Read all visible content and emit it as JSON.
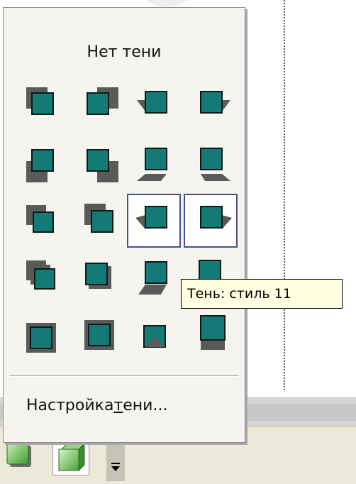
{
  "menu": {
    "no_shadow_label": "Нет тени",
    "settings_label_before": "Настройка ",
    "settings_label_underlined": "т",
    "settings_label_after": "ени..."
  },
  "tooltip": {
    "text": "Тень: стиль 11"
  },
  "shadow_styles": [
    {
      "style": 1
    },
    {
      "style": 2
    },
    {
      "style": 3
    },
    {
      "style": 4
    },
    {
      "style": 5
    },
    {
      "style": 6
    },
    {
      "style": 7
    },
    {
      "style": 8
    },
    {
      "style": 9
    },
    {
      "style": 10
    },
    {
      "style": 11,
      "highlighted": true
    },
    {
      "style": 12,
      "highlighted": true
    },
    {
      "style": 13
    },
    {
      "style": 14
    },
    {
      "style": 15
    },
    {
      "style": 16
    },
    {
      "style": 17
    },
    {
      "style": 18
    },
    {
      "style": 19
    },
    {
      "style": 20
    }
  ],
  "colors": {
    "square_fill": "#137a76",
    "square_border": "#0b1a1a",
    "shadow": "#5a5a5a",
    "highlight_border": "#46518a",
    "tooltip_bg": "#ffffe1"
  },
  "toolbar": {
    "icons": [
      "shadow-icon",
      "3d-style-icon",
      "dropdown-arrow-icon"
    ]
  }
}
